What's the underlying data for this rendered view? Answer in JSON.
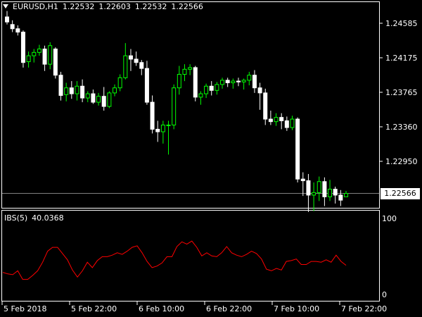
{
  "header": {
    "symbol": "EURUSD,H1",
    "open": "1.22532",
    "high": "1.22603",
    "low": "1.22532",
    "close": "1.22566"
  },
  "indicator": {
    "name": "IBS(5)",
    "value": "40.0368"
  },
  "price_axis": {
    "labels": [
      "1.24585",
      "1.24175",
      "1.23765",
      "1.23360",
      "1.22950"
    ],
    "current": "1.22566"
  },
  "ibs_axis": {
    "labels": [
      "100",
      "0"
    ]
  },
  "time_axis": {
    "labels": [
      "5 Feb 2018",
      "5 Feb 22:00",
      "6 Feb 10:00",
      "6 Feb 22:00",
      "7 Feb 10:00",
      "7 Feb 22:00"
    ]
  },
  "colors": {
    "bull": "#00ff00",
    "bear": "#ffffff",
    "ibs_line": "#ff0000",
    "price_line": "#808080",
    "background": "#000000"
  },
  "chart_data": {
    "type": "candlestick",
    "ohlc": [
      [
        1.2466,
        1.2473,
        1.2457,
        1.246
      ],
      [
        1.2457,
        1.2462,
        1.2448,
        1.2452
      ],
      [
        1.2452,
        1.2456,
        1.2444,
        1.2448
      ],
      [
        1.2448,
        1.245,
        1.2406,
        1.2412
      ],
      [
        1.2413,
        1.2425,
        1.2406,
        1.242
      ],
      [
        1.242,
        1.2428,
        1.2412,
        1.2424
      ],
      [
        1.2424,
        1.2433,
        1.242,
        1.2428
      ],
      [
        1.2428,
        1.2432,
        1.2402,
        1.241
      ],
      [
        1.241,
        1.2436,
        1.2404,
        1.2432
      ],
      [
        1.2428,
        1.243,
        1.2393,
        1.2397
      ],
      [
        1.2397,
        1.2401,
        1.2367,
        1.2373
      ],
      [
        1.2374,
        1.2388,
        1.2366,
        1.2382
      ],
      [
        1.2382,
        1.239,
        1.2369,
        1.2375
      ],
      [
        1.2375,
        1.239,
        1.2367,
        1.2384
      ],
      [
        1.2384,
        1.2392,
        1.2365,
        1.237
      ],
      [
        1.237,
        1.2378,
        1.2365,
        1.2375
      ],
      [
        1.2375,
        1.238,
        1.2363,
        1.2365
      ],
      [
        1.2365,
        1.2376,
        1.2361,
        1.2372
      ],
      [
        1.2372,
        1.2383,
        1.2355,
        1.236
      ],
      [
        1.236,
        1.2378,
        1.2358,
        1.2376
      ],
      [
        1.2376,
        1.2386,
        1.2372,
        1.2382
      ],
      [
        1.2382,
        1.2398,
        1.2378,
        1.2394
      ],
      [
        1.2394,
        1.2435,
        1.2392,
        1.242
      ],
      [
        1.242,
        1.2428,
        1.2402,
        1.2416
      ],
      [
        1.2416,
        1.2425,
        1.2408,
        1.2412
      ],
      [
        1.2412,
        1.2415,
        1.2397,
        1.2405
      ],
      [
        1.2405,
        1.2414,
        1.2362,
        1.2365
      ],
      [
        1.2365,
        1.2373,
        1.2328,
        1.2333
      ],
      [
        1.2333,
        1.2343,
        1.2318,
        1.233
      ],
      [
        1.233,
        1.2343,
        1.2316,
        1.2338
      ],
      [
        1.2338,
        1.2343,
        1.2303,
        1.2338
      ],
      [
        1.2338,
        1.2386,
        1.2333,
        1.2382
      ],
      [
        1.2382,
        1.2408,
        1.2374,
        1.2398
      ],
      [
        1.2398,
        1.241,
        1.239,
        1.2404
      ],
      [
        1.2404,
        1.241,
        1.2397,
        1.2406
      ],
      [
        1.2406,
        1.2408,
        1.2366,
        1.2371
      ],
      [
        1.2371,
        1.2378,
        1.2362,
        1.2375
      ],
      [
        1.2375,
        1.2387,
        1.237,
        1.2384
      ],
      [
        1.2384,
        1.239,
        1.2373,
        1.2379
      ],
      [
        1.2379,
        1.2389,
        1.2374,
        1.2386
      ],
      [
        1.2386,
        1.2394,
        1.2381,
        1.2391
      ],
      [
        1.2391,
        1.2394,
        1.2383,
        1.2388
      ],
      [
        1.2388,
        1.2393,
        1.2381,
        1.239
      ],
      [
        1.239,
        1.2394,
        1.2384,
        1.2389
      ],
      [
        1.2389,
        1.2393,
        1.238,
        1.2391
      ],
      [
        1.2391,
        1.2401,
        1.2385,
        1.2397
      ],
      [
        1.2397,
        1.2403,
        1.2376,
        1.2382
      ],
      [
        1.2382,
        1.2388,
        1.2356,
        1.2376
      ],
      [
        1.2376,
        1.2381,
        1.2338,
        1.2345
      ],
      [
        1.2345,
        1.2355,
        1.2338,
        1.2342
      ],
      [
        1.2342,
        1.2352,
        1.2337,
        1.2347
      ],
      [
        1.2347,
        1.2352,
        1.2333,
        1.2343
      ],
      [
        1.2343,
        1.2348,
        1.2331,
        1.2335
      ],
      [
        1.2335,
        1.2349,
        1.2332,
        1.2345
      ],
      [
        1.2345,
        1.2347,
        1.227,
        1.2274
      ],
      [
        1.2274,
        1.2282,
        1.2254,
        1.2272
      ],
      [
        1.2272,
        1.228,
        1.2235,
        1.2255
      ],
      [
        1.2255,
        1.227,
        1.2236,
        1.2258
      ],
      [
        1.2258,
        1.2277,
        1.2248,
        1.2271
      ],
      [
        1.2271,
        1.2276,
        1.2242,
        1.2253
      ],
      [
        1.2253,
        1.2273,
        1.2248,
        1.2262
      ],
      [
        1.2262,
        1.2265,
        1.2245,
        1.2255
      ],
      [
        1.2255,
        1.2261,
        1.2242,
        1.2249
      ],
      [
        1.2253,
        1.226,
        1.2253,
        1.2257
      ]
    ],
    "ibs": [
      31,
      29,
      28,
      33,
      22,
      22,
      27,
      33,
      44,
      58,
      63,
      63,
      55,
      47,
      34,
      25,
      33,
      44,
      37,
      46,
      51,
      51,
      53,
      56,
      54,
      58,
      63,
      65,
      56,
      45,
      37,
      39,
      43,
      51,
      51,
      64,
      70,
      67,
      71,
      63,
      52,
      56,
      52,
      51,
      56,
      64,
      56,
      53,
      51,
      54,
      58,
      55,
      48,
      35,
      33,
      36,
      34,
      45,
      46,
      48,
      41,
      41,
      45,
      45,
      44,
      47,
      44,
      53,
      45,
      40
    ],
    "price_ylim": [
      1.22455,
      1.2476
    ],
    "ibs_ylim": [
      0,
      100
    ]
  }
}
